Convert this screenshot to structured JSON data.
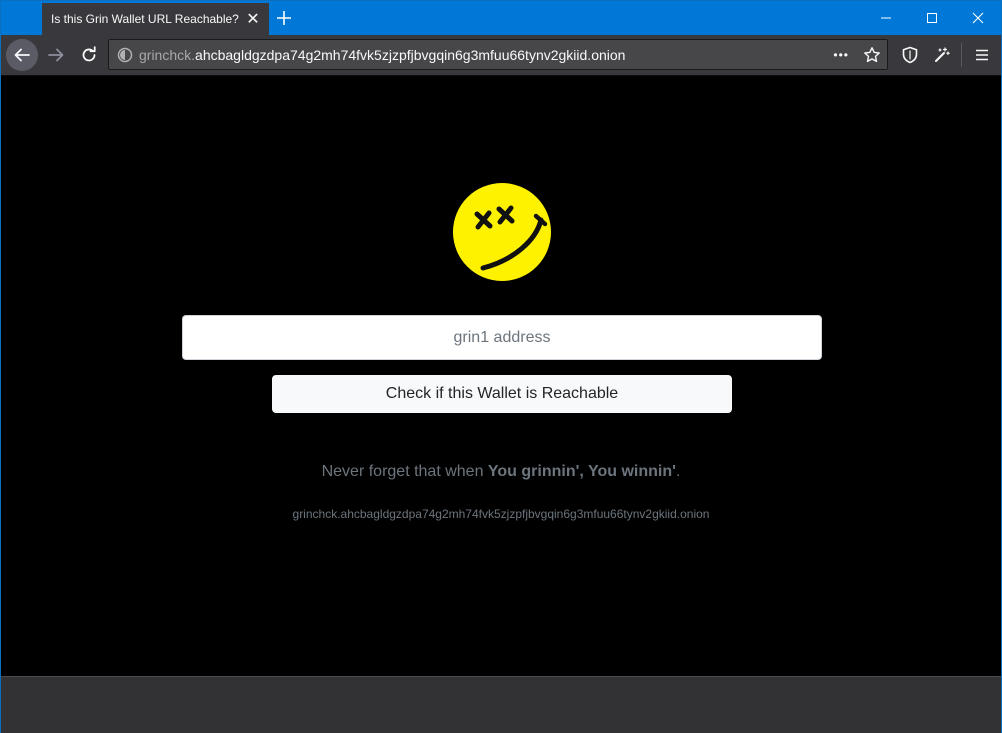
{
  "window": {
    "tab_title": "Is this Grin Wallet URL Reachable?",
    "tab_close": "✕",
    "new_tab": "+"
  },
  "navbar": {
    "url_prefix": "grinchck.",
    "url_main": "ahcbagldgzdpa74g2mh74fvk5zjzpfjbvgqin6g3mfuu66tynv2gkiid.onion",
    "page_actions": "•••"
  },
  "page": {
    "address_placeholder": "grin1 address",
    "check_button_label": "Check if this Wallet is Reachable",
    "tagline_before": "Never forget that when ",
    "tagline_bold": "You grinnin', You winnin'",
    "tagline_after": ".",
    "onion_address": "grinchck.ahcbagldgzdpa74g2mh74fvk5zjzpfjbvgqin6g3mfuu66tynv2gkiid.onion"
  },
  "colors": {
    "titlebar": "#0078d7",
    "toolbar": "#38383d",
    "logo_yellow": "#fff200",
    "muted_text": "#6c757d"
  }
}
